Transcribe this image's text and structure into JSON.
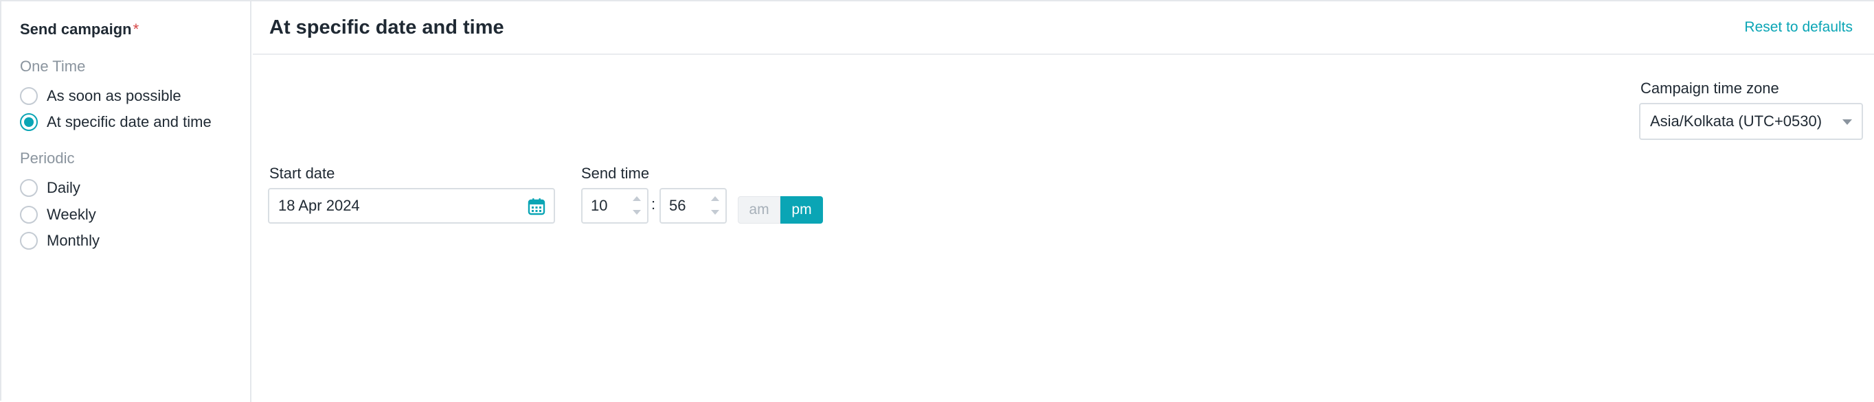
{
  "left_panel": {
    "title": "Send campaign",
    "required_mark": "*",
    "one_time": {
      "label": "One Time",
      "options": [
        {
          "label": "As soon as possible",
          "checked": false
        },
        {
          "label": "At specific date and time",
          "checked": true
        }
      ]
    },
    "periodic": {
      "label": "Periodic",
      "options": [
        {
          "label": "Daily",
          "checked": false
        },
        {
          "label": "Weekly",
          "checked": false
        },
        {
          "label": "Monthly",
          "checked": false
        }
      ]
    }
  },
  "header": {
    "title": "At specific date and time",
    "reset_label": "Reset to defaults"
  },
  "timezone": {
    "label": "Campaign time zone",
    "value": "Asia/Kolkata (UTC+0530)"
  },
  "start_date": {
    "label": "Start date",
    "value": "18 Apr 2024",
    "icon": "calendar-icon"
  },
  "send_time": {
    "label": "Send time",
    "hour": "10",
    "separator": ":",
    "minute": "56",
    "am_label": "am",
    "pm_label": "pm",
    "selected_period": "pm"
  },
  "colors": {
    "accent": "#0aa5b5",
    "text": "#1f2933",
    "muted": "#8a949e",
    "border": "#d9dee3",
    "required": "#d64545"
  }
}
